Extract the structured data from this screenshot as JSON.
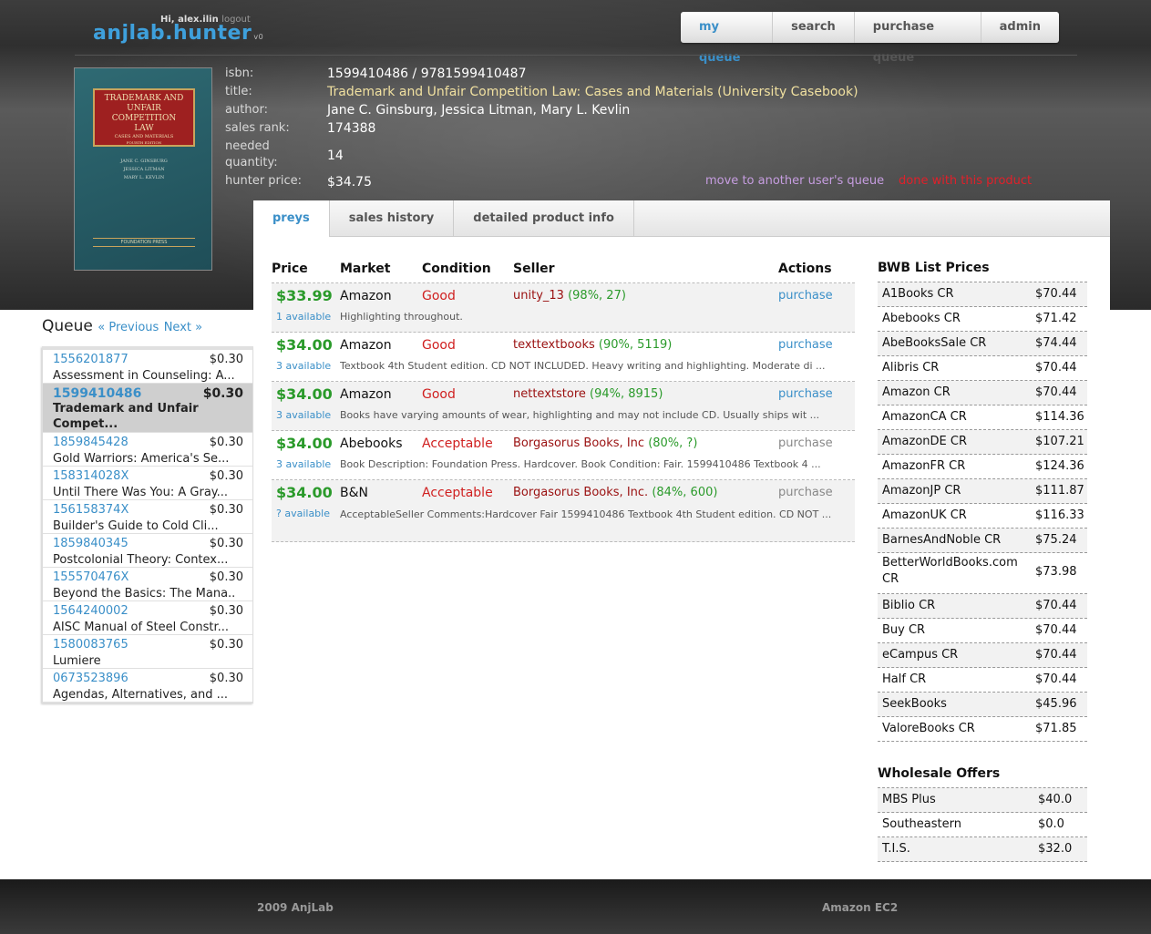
{
  "header": {
    "greeting": "Hi,",
    "username": "alex.ilin",
    "logout_label": "logout",
    "logo_text": "anjlab.hunter",
    "logo_version": "v0"
  },
  "nav": [
    "my queue",
    "search",
    "purchase queue",
    "admin"
  ],
  "cover": {
    "title_line1": "TRADEMARK AND",
    "title_line2": "UNFAIR COMPETITION",
    "title_line3": "LAW",
    "subtitle": "CASES AND MATERIALS",
    "edition": "FOURTH EDITION",
    "author1": "JANE C. GINSBURG",
    "author2": "JESSICA LITMAN",
    "author3": "MARY L. KEVLIN",
    "publisher": "FOUNDATION PRESS"
  },
  "product": {
    "isbn_label": "isbn:",
    "isbn": "1599410486 / 9781599410487",
    "title_label": "title:",
    "title": "Trademark and Unfair Competition Law: Cases and Materials (University Casebook)",
    "author_label": "author:",
    "author": "Jane C. Ginsburg, Jessica Litman, Mary L. Kevlin",
    "rank_label": "sales rank:",
    "rank": "174388",
    "qty_label_1": "needed",
    "qty_label_2": "quantity:",
    "qty": "14",
    "price_label": "hunter price:",
    "price": "$34.75",
    "move_link": "move to another user's queue",
    "done_link": "done with this product"
  },
  "tabs": [
    "preys",
    "sales history",
    "detailed product info"
  ],
  "preys": {
    "headers": {
      "price": "Price",
      "market": "Market",
      "condition": "Condition",
      "seller": "Seller",
      "actions": "Actions"
    },
    "rows": [
      {
        "price": "$33.99",
        "market": "Amazon",
        "condition": "Good",
        "seller": "unity_13",
        "rating": "(98%, 27)",
        "action": "purchase",
        "available": "1 available",
        "desc": "Highlighting throughout."
      },
      {
        "price": "$34.00",
        "market": "Amazon",
        "condition": "Good",
        "seller": "texttextbooks",
        "rating": "(90%, 5119)",
        "action": "purchase",
        "available": "3 available",
        "desc": "Textbook 4th Student edition. CD NOT INCLUDED. Heavy writing and highlighting. Moderate di ..."
      },
      {
        "price": "$34.00",
        "market": "Amazon",
        "condition": "Good",
        "seller": "nettextstore",
        "rating": "(94%, 8915)",
        "action": "purchase",
        "available": "3 available",
        "desc": "Books have varying amounts of wear, highlighting and may not include CD. Usually ships wit ..."
      },
      {
        "price": "$34.00",
        "market": "Abebooks",
        "condition": "Acceptable",
        "seller": "Borgasorus Books, Inc",
        "rating": "(80%, ?)",
        "action": "purchase",
        "available": "3 available",
        "desc": "Book Description: Foundation Press. Hardcover. Book Condition: Fair. 1599410486 Textbook 4 ..."
      },
      {
        "price": "$34.00",
        "market": "B&N",
        "condition": "Acceptable",
        "seller": "Borgasorus Books, Inc.",
        "rating": "(84%, 600)",
        "action": "purchase",
        "available": "? available",
        "desc": "AcceptableSeller Comments:Hardcover Fair 1599410486 Textbook 4th Student edition. CD NOT ..."
      }
    ]
  },
  "bwb": {
    "title": "BWB List Prices",
    "rows": [
      {
        "name": "A1Books CR",
        "price": "$70.44"
      },
      {
        "name": "Abebooks CR",
        "price": "$71.42"
      },
      {
        "name": "AbeBooksSale CR",
        "price": "$74.44"
      },
      {
        "name": "Alibris CR",
        "price": "$70.44"
      },
      {
        "name": "Amazon CR",
        "price": "$70.44"
      },
      {
        "name": "AmazonCA CR",
        "price": "$114.36"
      },
      {
        "name": "AmazonDE CR",
        "price": "$107.21"
      },
      {
        "name": "AmazonFR CR",
        "price": "$124.36"
      },
      {
        "name": "AmazonJP CR",
        "price": "$111.87"
      },
      {
        "name": "AmazonUK CR",
        "price": "$116.33"
      },
      {
        "name": "BarnesAndNoble CR",
        "price": "$75.24"
      },
      {
        "name": "BetterWorldBooks.com CR",
        "price": "$73.98"
      },
      {
        "name": "Biblio CR",
        "price": "$70.44"
      },
      {
        "name": "Buy CR",
        "price": "$70.44"
      },
      {
        "name": "eCampus CR",
        "price": "$70.44"
      },
      {
        "name": "Half CR",
        "price": "$70.44"
      },
      {
        "name": "SeekBooks",
        "price": "$45.96"
      },
      {
        "name": "ValoreBooks CR",
        "price": "$71.85"
      }
    ]
  },
  "wholesale": {
    "title": "Wholesale Offers",
    "rows": [
      {
        "name": "MBS Plus",
        "price": "$40.0"
      },
      {
        "name": "Southeastern",
        "price": "$0.0"
      },
      {
        "name": "T.I.S.",
        "price": "$32.0"
      }
    ]
  },
  "queue": {
    "title": "Queue",
    "prev": "« Previous",
    "next": "Next »",
    "items": [
      {
        "isbn": "1556201877",
        "price": "$0.30",
        "title": "Assessment in Counseling: A..."
      },
      {
        "isbn": "1599410486",
        "price": "$0.30",
        "title": "Trademark and Unfair Compet..."
      },
      {
        "isbn": "1859845428",
        "price": "$0.30",
        "title": "Gold Warriors: America's Se..."
      },
      {
        "isbn": "158314028X",
        "price": "$0.30",
        "title": "Until There Was You: A Gray..."
      },
      {
        "isbn": "156158374X",
        "price": "$0.30",
        "title": "Builder's Guide to Cold Cli..."
      },
      {
        "isbn": "1859840345",
        "price": "$0.30",
        "title": "Postcolonial Theory: Contex..."
      },
      {
        "isbn": "155570476X",
        "price": "$0.30",
        "title": "Beyond the Basics: The Mana..."
      },
      {
        "isbn": "1564240002",
        "price": "$0.30",
        "title": "AISC Manual of Steel Constr..."
      },
      {
        "isbn": "1580083765",
        "price": "$0.30",
        "title": "Lumiere"
      },
      {
        "isbn": "0673523896",
        "price": "$0.30",
        "title": "Agendas, Alternatives, and ..."
      }
    ]
  },
  "footer": {
    "left": "2009 AnjLab",
    "right": "Amazon EC2"
  }
}
